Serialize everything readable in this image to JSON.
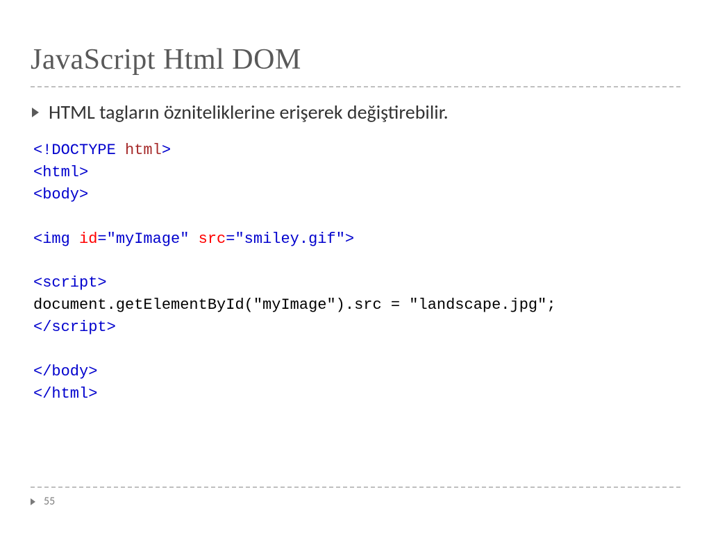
{
  "title": "JavaScript Html DOM",
  "bullet": "HTML tagların özniteliklerine erişerek değiştirebilir.",
  "code": {
    "l1a": "<!DOCTYPE",
    "l1b": " html",
    "l1c": ">",
    "l2a": "<html>",
    "l3a": "<body>",
    "blank1": "",
    "l4a": "<img",
    "l4b": " id",
    "l4c": "=\"myImage\"",
    "l4d": " src",
    "l4e": "=\"smiley.gif\"",
    "l4f": ">",
    "blank2": "",
    "l5a": "<script>",
    "l6": "document.getElementById(\"myImage\").src = \"landscape.jpg\";",
    "l7a": "</script>",
    "blank3": "",
    "l8a": "</body>",
    "l9a": "</html>"
  },
  "page": "55"
}
